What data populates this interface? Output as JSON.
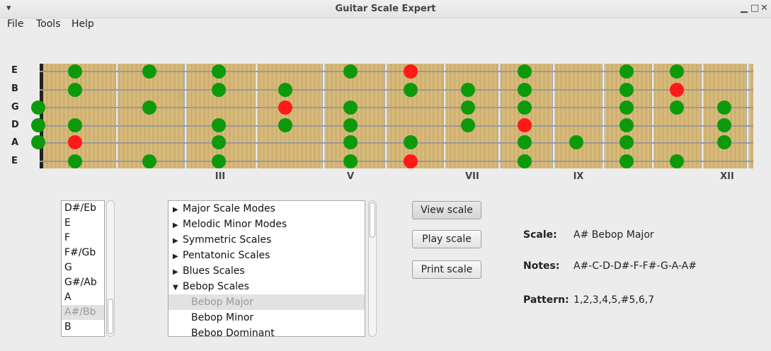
{
  "window": {
    "title": "Guitar Scale Expert",
    "menu_glyph": "▾",
    "minimize_glyph": "▁",
    "maximize_glyph": "□",
    "close_glyph": "✕"
  },
  "menubar": {
    "items": [
      "File",
      "Tools",
      "Help"
    ]
  },
  "fretboard": {
    "strings": [
      "E",
      "B",
      "G",
      "D",
      "A",
      "E"
    ],
    "position_markers": [
      "III",
      "V",
      "VII",
      "IX",
      "XII"
    ],
    "dot_colors": {
      "scale_note": "#0c9a0c",
      "root_note": "#ff1a1a"
    }
  },
  "notes_list": {
    "items": [
      "D#/Eb",
      "E",
      "F",
      "F#/Gb",
      "G",
      "G#/Ab",
      "A",
      "A#/Bb",
      "B"
    ],
    "selected": "A#/Bb"
  },
  "scale_tree": {
    "items": [
      {
        "label": "Major Scale Modes",
        "type": "group",
        "expanded": false
      },
      {
        "label": "Melodic Minor Modes",
        "type": "group",
        "expanded": false
      },
      {
        "label": "Symmetric Scales",
        "type": "group",
        "expanded": false
      },
      {
        "label": "Pentatonic Scales",
        "type": "group",
        "expanded": false
      },
      {
        "label": "Blues Scales",
        "type": "group",
        "expanded": false
      },
      {
        "label": "Bebop Scales",
        "type": "group",
        "expanded": true
      },
      {
        "label": "Bebop Major",
        "type": "child",
        "selected": true
      },
      {
        "label": "Bebop Minor",
        "type": "child"
      },
      {
        "label": "Bebop Dominant",
        "type": "child"
      }
    ]
  },
  "buttons": {
    "view": "View scale",
    "play": "Play scale",
    "print": "Print scale"
  },
  "info": {
    "scale_label": "Scale:",
    "scale_value": "A# Bebop Major",
    "notes_label": "Notes:",
    "notes_value": "A#-C-D-D#-F-F#-G-A-A#",
    "pattern_label": "Pattern:",
    "pattern_value": "1,2,3,4,5,#5,6,7"
  }
}
